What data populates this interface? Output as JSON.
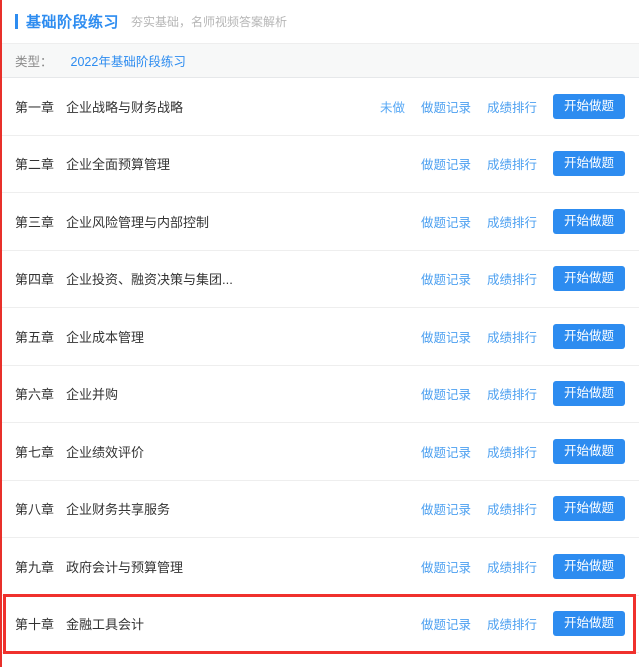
{
  "header": {
    "title": "基础阶段练习",
    "subtitle": "夯实基础，名师视频答案解析",
    "accent_color": "#2d8cf0"
  },
  "filter": {
    "label": "类型：",
    "selected_option": "2022年基础阶段练习",
    "options": [
      "2022年基础阶段练习"
    ]
  },
  "labels": {
    "record_link": "做题记录",
    "ranking_link": "成绩排行",
    "start_button": "开始做题",
    "undone_status": "未做"
  },
  "colors": {
    "primary_blue": "#2d8cf0",
    "link_blue": "#4da0f0",
    "highlight_red": "#f0312d",
    "divider_gray": "#eeeeee",
    "filter_bg": "#f7f8f8"
  },
  "chapters": [
    {
      "no": "第一章",
      "name": "企业战略与财务战略",
      "status": "未做",
      "record": "做题记录",
      "ranking": "成绩排行",
      "start": "开始做题",
      "highlighted": false
    },
    {
      "no": "第二章",
      "name": "企业全面预算管理",
      "status": "",
      "record": "做题记录",
      "ranking": "成绩排行",
      "start": "开始做题",
      "highlighted": false
    },
    {
      "no": "第三章",
      "name": "企业风险管理与内部控制",
      "status": "",
      "record": "做题记录",
      "ranking": "成绩排行",
      "start": "开始做题",
      "highlighted": false
    },
    {
      "no": "第四章",
      "name": "企业投资、融资决策与集团...",
      "status": "",
      "record": "做题记录",
      "ranking": "成绩排行",
      "start": "开始做题",
      "highlighted": false
    },
    {
      "no": "第五章",
      "name": "企业成本管理",
      "status": "",
      "record": "做题记录",
      "ranking": "成绩排行",
      "start": "开始做题",
      "highlighted": false
    },
    {
      "no": "第六章",
      "name": "企业并购",
      "status": "",
      "record": "做题记录",
      "ranking": "成绩排行",
      "start": "开始做题",
      "highlighted": false
    },
    {
      "no": "第七章",
      "name": "企业绩效评价",
      "status": "",
      "record": "做题记录",
      "ranking": "成绩排行",
      "start": "开始做题",
      "highlighted": false
    },
    {
      "no": "第八章",
      "name": "企业财务共享服务",
      "status": "",
      "record": "做题记录",
      "ranking": "成绩排行",
      "start": "开始做题",
      "highlighted": false
    },
    {
      "no": "第九章",
      "name": "政府会计与预算管理",
      "status": "",
      "record": "做题记录",
      "ranking": "成绩排行",
      "start": "开始做题",
      "highlighted": false
    },
    {
      "no": "第十章",
      "name": "金融工具会计",
      "status": "",
      "record": "做题记录",
      "ranking": "成绩排行",
      "start": "开始做题",
      "highlighted": true
    }
  ]
}
